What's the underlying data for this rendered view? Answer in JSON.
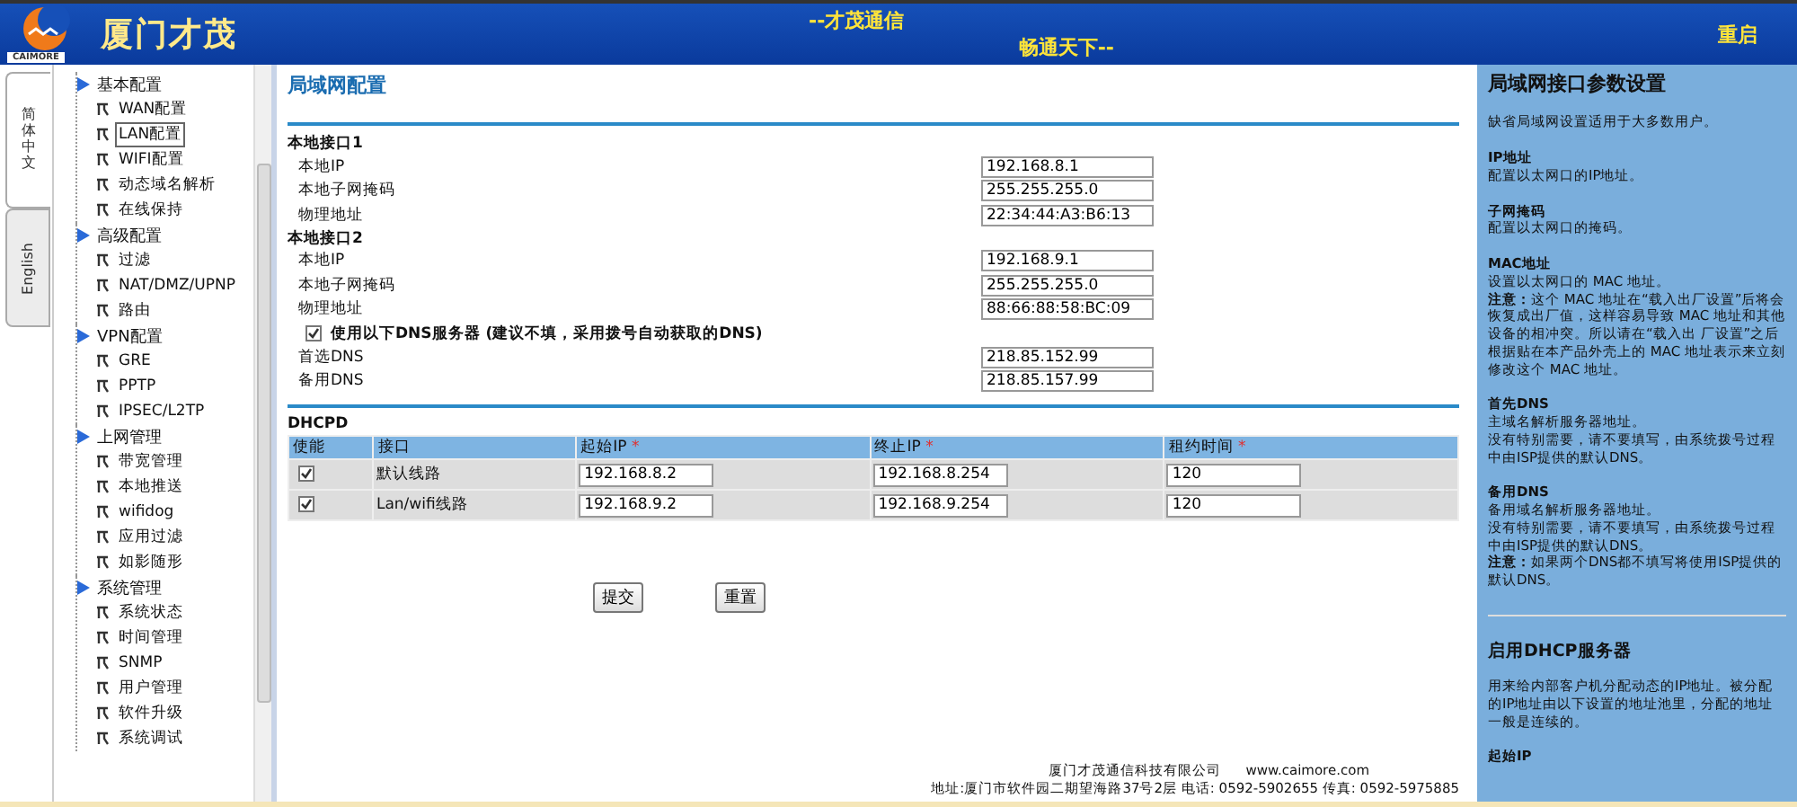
{
  "header": {
    "brand": "厦门才茂",
    "logo_caption": "CAIMORE",
    "slogan_1": "--才茂通信",
    "slogan_2": "畅通天下--",
    "restart": "重启"
  },
  "lang_tabs": [
    {
      "label": "简体中文",
      "selected": true
    },
    {
      "label": "English",
      "selected": false
    }
  ],
  "nav": [
    {
      "label": "基本配置",
      "children": [
        {
          "label": "WAN配置",
          "selected": false
        },
        {
          "label": "LAN配置",
          "selected": true
        },
        {
          "label": "WIFI配置",
          "selected": false
        },
        {
          "label": "动态域名解析",
          "selected": false
        },
        {
          "label": "在线保持",
          "selected": false
        }
      ]
    },
    {
      "label": "高级配置",
      "children": [
        {
          "label": "过滤",
          "selected": false
        },
        {
          "label": "NAT/DMZ/UPNP",
          "selected": false
        },
        {
          "label": "路由",
          "selected": false
        }
      ]
    },
    {
      "label": "VPN配置",
      "children": [
        {
          "label": "GRE",
          "selected": false
        },
        {
          "label": "PPTP",
          "selected": false
        },
        {
          "label": "IPSEC/L2TP",
          "selected": false
        }
      ]
    },
    {
      "label": "上网管理",
      "children": [
        {
          "label": "带宽管理",
          "selected": false
        },
        {
          "label": "本地推送",
          "selected": false
        },
        {
          "label": "wifidog",
          "selected": false
        },
        {
          "label": "应用过滤",
          "selected": false
        },
        {
          "label": "如影随形",
          "selected": false
        }
      ]
    },
    {
      "label": "系统管理",
      "children": [
        {
          "label": "系统状态",
          "selected": false
        },
        {
          "label": "时间管理",
          "selected": false
        },
        {
          "label": "SNMP",
          "selected": false
        },
        {
          "label": "用户管理",
          "selected": false
        },
        {
          "label": "软件升级",
          "selected": false
        },
        {
          "label": "系统调试",
          "selected": false
        }
      ]
    }
  ],
  "main": {
    "title": "局域网配置",
    "interfaces": [
      {
        "heading": "本地接口1",
        "fields": [
          {
            "label": "本地IP",
            "value": "192.168.8.1"
          },
          {
            "label": "本地子网掩码",
            "value": "255.255.255.0"
          },
          {
            "label": "物理地址",
            "value": "22:34:44:A3:B6:13"
          }
        ]
      },
      {
        "heading": "本地接口2",
        "fields": [
          {
            "label": "本地IP",
            "value": "192.168.9.1"
          },
          {
            "label": "本地子网掩码",
            "value": "255.255.255.0"
          },
          {
            "label": "物理地址",
            "value": "88:66:88:58:BC:09"
          }
        ]
      }
    ],
    "dns_toggle": {
      "label": "使用以下DNS服务器 (建议不填，采用拨号自动获取的DNS)",
      "checked": true
    },
    "dns_fields": [
      {
        "label": "首选DNS",
        "value": "218.85.152.99"
      },
      {
        "label": "备用DNS",
        "value": "218.85.157.99"
      }
    ],
    "dhcp": {
      "heading": "DHCPD",
      "columns": [
        {
          "label": "使能"
        },
        {
          "label": "接口"
        },
        {
          "label": "起始IP",
          "note": "*"
        },
        {
          "label": "终止IP",
          "note": "*"
        },
        {
          "label": "租约时间",
          "note": "*"
        }
      ],
      "rows": [
        {
          "enabled": true,
          "interface": "默认线路",
          "start": "192.168.8.2",
          "end": "192.168.8.254",
          "lease": "120"
        },
        {
          "enabled": true,
          "interface": "Lan/wifi线路",
          "start": "192.168.9.2",
          "end": "192.168.9.254",
          "lease": "120"
        }
      ]
    },
    "buttons": [
      "提交",
      "重置"
    ],
    "footer": {
      "company": "厦门才茂通信科技有限公司",
      "website": "www.caimore.com",
      "address": "地址:厦门市软件园二期望海路37号2层 电话: 0592-5902655 传真: 0592-5975885"
    }
  },
  "help": {
    "title": "局域网接口参数设置",
    "intro": "缺省局域网设置适用于大多数用户。",
    "sections": [
      {
        "heading": "IP地址",
        "paragraphs": [
          "配置以太网口的IP地址。"
        ]
      },
      {
        "heading": "子网掩码",
        "paragraphs": [
          "配置以太网口的掩码。"
        ]
      },
      {
        "heading": "MAC地址",
        "paragraphs": [
          "设置以太网口的 MAC 地址。",
          "**注意：**这个 MAC 地址在“载入出厂设置”后将会恢复成出厂值，这样容易导致 MAC 地址和其他设备的相冲突。所以请在“载入出 厂设置”之后根据贴在本产品外壳上的 MAC 地址表示来立刻修改这个 MAC 地址。"
        ]
      },
      {
        "heading": "首先DNS",
        "paragraphs": [
          "主域名解析服务器地址。",
          "没有特别需要，请不要填写，由系统拨号过程中由ISP提供的默认DNS。"
        ]
      },
      {
        "heading": "备用DNS",
        "paragraphs": [
          "备用域名解析服务器地址。",
          "没有特别需要，请不要填写，由系统拨号过程中由ISP提供的默认DNS。",
          "**注意：**如果两个DNS都不填写将使用ISP提供的默认DNS。"
        ]
      }
    ],
    "dhcp_title": "启用DHCP服务器",
    "dhcp_sections": [
      {
        "paragraphs": [
          "用来给内部客户机分配动态的IP地址。被分配的IP地址由以下设置的地址池里，分配的地址一般是连续的。"
        ]
      },
      {
        "heading": "起始IP"
      }
    ]
  }
}
